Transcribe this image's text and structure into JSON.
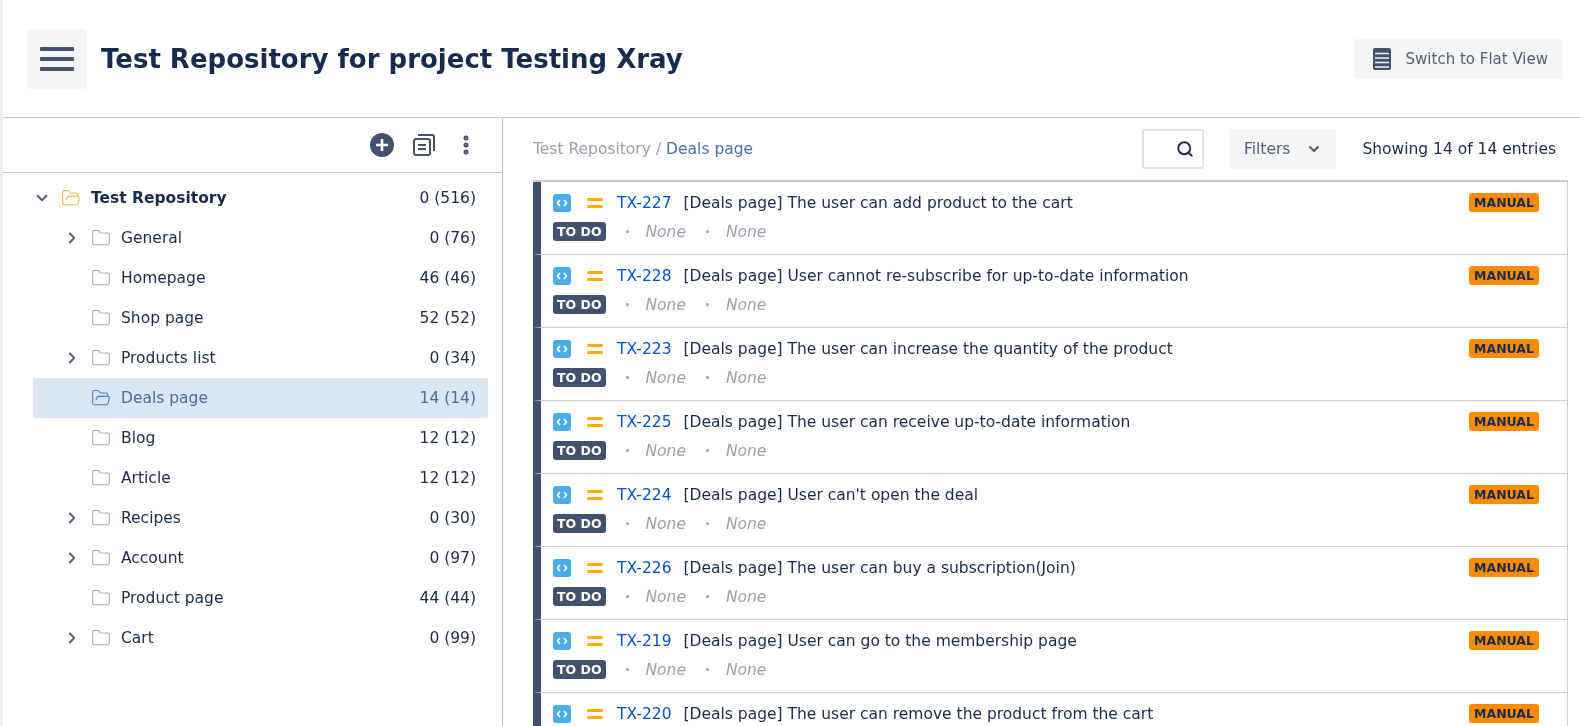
{
  "header": {
    "title": "Test Repository for project Testing Xray",
    "flat_view_button": "Switch to Flat View"
  },
  "tree": {
    "root": {
      "label": "Test Repository",
      "count": "0 (516)",
      "expanded": true,
      "selected": false,
      "children": [
        {
          "label": "General",
          "count": "0 (76)",
          "expandable": true,
          "expanded": false,
          "selected": false
        },
        {
          "label": "Homepage",
          "count": "46 (46)",
          "expandable": false,
          "expanded": false,
          "selected": false
        },
        {
          "label": "Shop page",
          "count": "52 (52)",
          "expandable": false,
          "expanded": false,
          "selected": false
        },
        {
          "label": "Products list",
          "count": "0 (34)",
          "expandable": true,
          "expanded": false,
          "selected": false
        },
        {
          "label": "Deals page",
          "count": "14 (14)",
          "expandable": false,
          "expanded": false,
          "selected": true
        },
        {
          "label": "Blog",
          "count": "12 (12)",
          "expandable": false,
          "expanded": false,
          "selected": false
        },
        {
          "label": "Article",
          "count": "12 (12)",
          "expandable": false,
          "expanded": false,
          "selected": false
        },
        {
          "label": "Recipes",
          "count": "0 (30)",
          "expandable": true,
          "expanded": false,
          "selected": false
        },
        {
          "label": "Account",
          "count": "0 (97)",
          "expandable": true,
          "expanded": false,
          "selected": false
        },
        {
          "label": "Product page",
          "count": "44 (44)",
          "expandable": false,
          "expanded": false,
          "selected": false
        },
        {
          "label": "Cart",
          "count": "0 (99)",
          "expandable": true,
          "expanded": false,
          "selected": false
        }
      ]
    }
  },
  "breadcrumb": {
    "root": "Test Repository",
    "separator": "/",
    "current": "Deals page"
  },
  "filters_button": "Filters",
  "entries_count": "Showing 14 of 14 entries",
  "tests": [
    {
      "key": "TX-227",
      "summary": "[Deals page] The user can add product to the cart",
      "status": "TO DO",
      "meta_1": "None",
      "meta_2": "None",
      "type": "MANUAL"
    },
    {
      "key": "TX-228",
      "summary": "[Deals page] User cannot re-subscribe for up-to-date information",
      "status": "TO DO",
      "meta_1": "None",
      "meta_2": "None",
      "type": "MANUAL"
    },
    {
      "key": "TX-223",
      "summary": "[Deals page] The user can increase the quantity of the product",
      "status": "TO DO",
      "meta_1": "None",
      "meta_2": "None",
      "type": "MANUAL"
    },
    {
      "key": "TX-225",
      "summary": "[Deals page] The user can receive up-to-date information",
      "status": "TO DO",
      "meta_1": "None",
      "meta_2": "None",
      "type": "MANUAL"
    },
    {
      "key": "TX-224",
      "summary": "[Deals page] User can't open the deal",
      "status": "TO DO",
      "meta_1": "None",
      "meta_2": "None",
      "type": "MANUAL"
    },
    {
      "key": "TX-226",
      "summary": "[Deals page] The user can buy a subscription(Join)",
      "status": "TO DO",
      "meta_1": "None",
      "meta_2": "None",
      "type": "MANUAL"
    },
    {
      "key": "TX-219",
      "summary": "[Deals page] User can go to the membership page",
      "status": "TO DO",
      "meta_1": "None",
      "meta_2": "None",
      "type": "MANUAL"
    },
    {
      "key": "TX-220",
      "summary": "[Deals page] The user can remove the product from the cart",
      "type": "MANUAL"
    }
  ]
}
